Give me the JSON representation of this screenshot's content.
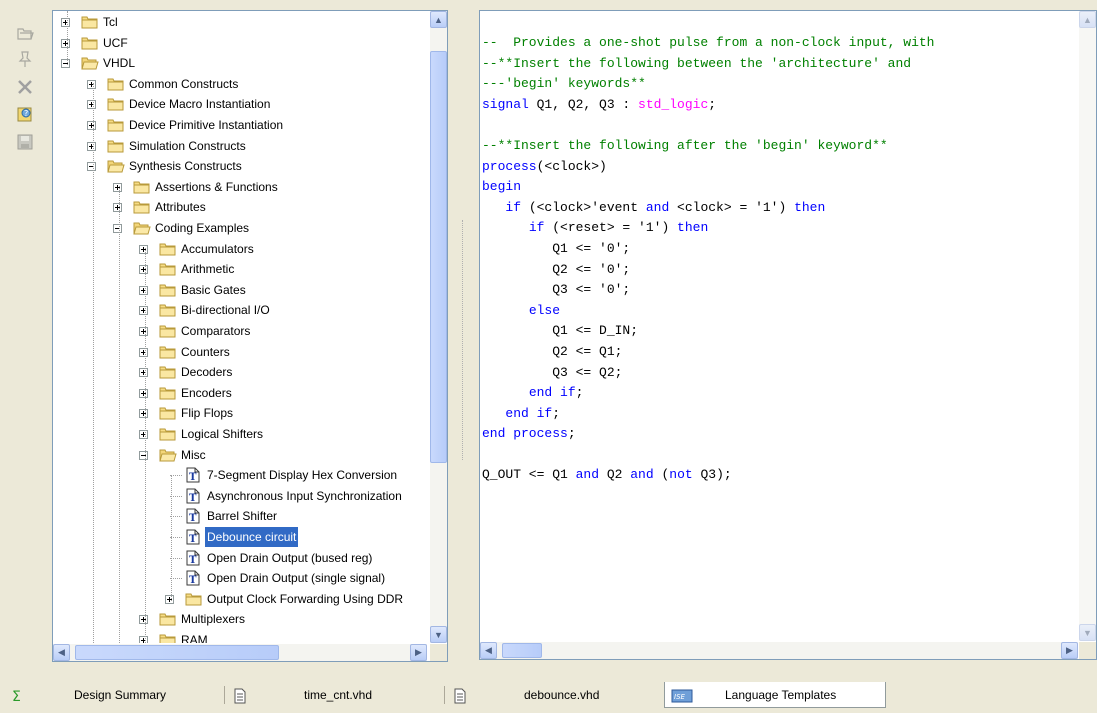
{
  "toolbar": {
    "buttons": [
      {
        "name": "open-folder-icon"
      },
      {
        "name": "pin-icon"
      },
      {
        "name": "delete-icon"
      },
      {
        "name": "help-icon"
      },
      {
        "name": "save-icon"
      }
    ]
  },
  "tree": {
    "items": [
      {
        "label": "Tcl",
        "level": 0,
        "type": "folder",
        "state": "collapsed"
      },
      {
        "label": "UCF",
        "level": 0,
        "type": "folder",
        "state": "collapsed"
      },
      {
        "label": "VHDL",
        "level": 0,
        "type": "folder",
        "state": "expanded"
      },
      {
        "label": "Common Constructs",
        "level": 1,
        "type": "folder",
        "state": "collapsed"
      },
      {
        "label": "Device Macro Instantiation",
        "level": 1,
        "type": "folder",
        "state": "collapsed"
      },
      {
        "label": "Device Primitive Instantiation",
        "level": 1,
        "type": "folder",
        "state": "collapsed"
      },
      {
        "label": "Simulation Constructs",
        "level": 1,
        "type": "folder",
        "state": "collapsed"
      },
      {
        "label": "Synthesis Constructs",
        "level": 1,
        "type": "folder",
        "state": "expanded"
      },
      {
        "label": "Assertions & Functions",
        "level": 2,
        "type": "folder",
        "state": "collapsed"
      },
      {
        "label": "Attributes",
        "level": 2,
        "type": "folder",
        "state": "collapsed"
      },
      {
        "label": "Coding Examples",
        "level": 2,
        "type": "folder",
        "state": "expanded"
      },
      {
        "label": "Accumulators",
        "level": 3,
        "type": "folder",
        "state": "collapsed"
      },
      {
        "label": "Arithmetic",
        "level": 3,
        "type": "folder",
        "state": "collapsed"
      },
      {
        "label": "Basic Gates",
        "level": 3,
        "type": "folder",
        "state": "collapsed"
      },
      {
        "label": "Bi-directional I/O",
        "level": 3,
        "type": "folder",
        "state": "collapsed"
      },
      {
        "label": "Comparators",
        "level": 3,
        "type": "folder",
        "state": "collapsed"
      },
      {
        "label": "Counters",
        "level": 3,
        "type": "folder",
        "state": "collapsed"
      },
      {
        "label": "Decoders",
        "level": 3,
        "type": "folder",
        "state": "collapsed"
      },
      {
        "label": "Encoders",
        "level": 3,
        "type": "folder",
        "state": "collapsed"
      },
      {
        "label": "Flip Flops",
        "level": 3,
        "type": "folder",
        "state": "collapsed"
      },
      {
        "label": "Logical Shifters",
        "level": 3,
        "type": "folder",
        "state": "collapsed"
      },
      {
        "label": "Misc",
        "level": 3,
        "type": "folder",
        "state": "expanded"
      },
      {
        "label": "7-Segment Display Hex Conversion",
        "level": 4,
        "type": "template",
        "state": "leaf"
      },
      {
        "label": "Asynchronous Input Synchronization",
        "level": 4,
        "type": "template",
        "state": "leaf"
      },
      {
        "label": "Barrel Shifter",
        "level": 4,
        "type": "template",
        "state": "leaf"
      },
      {
        "label": "Debounce circuit",
        "level": 4,
        "type": "template",
        "state": "leaf",
        "selected": true
      },
      {
        "label": "Open Drain Output (bused reg)",
        "level": 4,
        "type": "template",
        "state": "leaf"
      },
      {
        "label": "Open Drain Output (single signal)",
        "level": 4,
        "type": "template",
        "state": "leaf"
      },
      {
        "label": "Output Clock Forwarding Using DDR",
        "level": 4,
        "type": "folder",
        "state": "collapsed"
      },
      {
        "label": "Multiplexers",
        "level": 3,
        "type": "folder",
        "state": "collapsed"
      },
      {
        "label": "RAM",
        "level": 3,
        "type": "folder",
        "state": "collapsed"
      }
    ]
  },
  "code": {
    "lines": [
      [
        {
          "t": "--  Provides a one-shot pulse from a non-clock input, with",
          "c": "com"
        }
      ],
      [
        {
          "t": "--**Insert the following between the 'architecture' and",
          "c": "com"
        }
      ],
      [
        {
          "t": "---'begin' keywords**",
          "c": "com"
        }
      ],
      [
        {
          "t": "signal",
          "c": "kw"
        },
        {
          "t": " Q1, Q2, Q3 : ",
          "c": "txt"
        },
        {
          "t": "std_logic",
          "c": "type"
        },
        {
          "t": ";",
          "c": "txt"
        }
      ],
      [],
      [
        {
          "t": "--**Insert the following after the 'begin' keyword**",
          "c": "com"
        }
      ],
      [
        {
          "t": "process",
          "c": "kw"
        },
        {
          "t": "(<clock>)",
          "c": "txt"
        }
      ],
      [
        {
          "t": "begin",
          "c": "kw"
        }
      ],
      [
        {
          "t": "   ",
          "c": "txt"
        },
        {
          "t": "if",
          "c": "kw"
        },
        {
          "t": " (<clock>'event ",
          "c": "txt"
        },
        {
          "t": "and",
          "c": "kw"
        },
        {
          "t": " <clock> = '1') ",
          "c": "txt"
        },
        {
          "t": "then",
          "c": "kw"
        }
      ],
      [
        {
          "t": "      ",
          "c": "txt"
        },
        {
          "t": "if",
          "c": "kw"
        },
        {
          "t": " (<reset> = '1') ",
          "c": "txt"
        },
        {
          "t": "then",
          "c": "kw"
        }
      ],
      [
        {
          "t": "         Q1 <= '0';",
          "c": "txt"
        }
      ],
      [
        {
          "t": "         Q2 <= '0';",
          "c": "txt"
        }
      ],
      [
        {
          "t": "         Q3 <= '0';",
          "c": "txt"
        }
      ],
      [
        {
          "t": "      ",
          "c": "txt"
        },
        {
          "t": "else",
          "c": "kw"
        }
      ],
      [
        {
          "t": "         Q1 <= D_IN;",
          "c": "txt"
        }
      ],
      [
        {
          "t": "         Q2 <= Q1;",
          "c": "txt"
        }
      ],
      [
        {
          "t": "         Q3 <= Q2;",
          "c": "txt"
        }
      ],
      [
        {
          "t": "      ",
          "c": "txt"
        },
        {
          "t": "end if",
          "c": "kw"
        },
        {
          "t": ";",
          "c": "txt"
        }
      ],
      [
        {
          "t": "   ",
          "c": "txt"
        },
        {
          "t": "end if",
          "c": "kw"
        },
        {
          "t": ";",
          "c": "txt"
        }
      ],
      [
        {
          "t": "end process",
          "c": "kw"
        },
        {
          "t": ";",
          "c": "txt"
        }
      ],
      [],
      [
        {
          "t": "Q_OUT <= Q1 ",
          "c": "txt"
        },
        {
          "t": "and",
          "c": "kw"
        },
        {
          "t": " Q2 ",
          "c": "txt"
        },
        {
          "t": "and",
          "c": "kw"
        },
        {
          "t": " (",
          "c": "txt"
        },
        {
          "t": "not",
          "c": "kw"
        },
        {
          "t": " Q3);",
          "c": "txt"
        }
      ]
    ]
  },
  "tabs": [
    {
      "label": "Design Summary",
      "icon": "sigma-icon",
      "active": false
    },
    {
      "label": "time_cnt.vhd",
      "icon": "document-icon",
      "active": false
    },
    {
      "label": "debounce.vhd",
      "icon": "document-icon",
      "active": false
    },
    {
      "label": "Language Templates",
      "icon": "ise-icon",
      "active": true
    }
  ],
  "colors": {
    "selection": "#316ac5",
    "comment": "#008000",
    "keyword": "#0000ff",
    "type": "#ff00ff"
  }
}
